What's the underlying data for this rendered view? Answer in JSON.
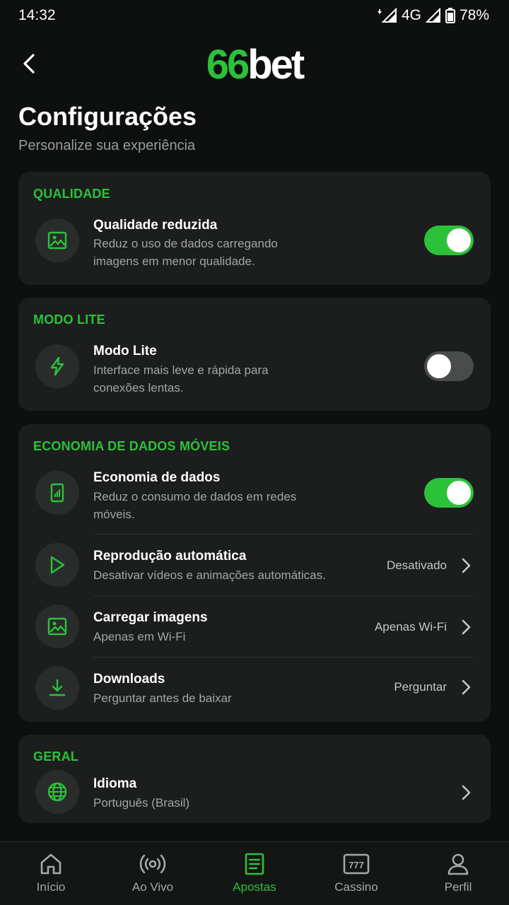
{
  "status_bar": {
    "time": "14:32",
    "network": "4G",
    "battery": "78%"
  },
  "header": {
    "logo_number": "66",
    "logo_word": "bet"
  },
  "page": {
    "title": "Configurações",
    "subtitle": "Personalize sua experiência"
  },
  "sections": {
    "quality": {
      "title": "QUALIDADE",
      "rows": [
        {
          "title": "Qualidade reduzida",
          "desc": "Reduz o uso de dados carregando imagens em menor qualidade.",
          "toggle": true,
          "icon": "image-icon"
        }
      ]
    },
    "lite": {
      "title": "MODO LITE",
      "rows": [
        {
          "title": "Modo Lite",
          "desc": "Interface mais leve e rápida para conexões lentas.",
          "toggle": false,
          "icon": "lightning-icon"
        }
      ]
    },
    "data": {
      "title": "ECONOMIA DE DADOS MÓVEIS",
      "rows": [
        {
          "title": "Economia de dados",
          "desc": "Reduz o consumo de dados em redes móveis.",
          "toggle": true,
          "icon": "mobile-data-icon"
        },
        {
          "title": "Reprodução automática",
          "desc": "Desativar vídeos e animações automáticas.",
          "value": "Desativado",
          "icon": "autoplay-icon"
        },
        {
          "title": "Carregar imagens",
          "desc": "Apenas em Wi-Fi",
          "value": "Apenas Wi-Fi",
          "icon": "image-icon"
        },
        {
          "title": "Downloads",
          "desc": "Perguntar antes de baixar",
          "value": "Perguntar",
          "icon": "download-icon"
        }
      ]
    },
    "general": {
      "title": "GERAL",
      "rows": [
        {
          "title": "Idioma",
          "desc": "Português (Brasil)",
          "icon": "globe-icon"
        }
      ]
    }
  },
  "bottom_nav": {
    "items": [
      {
        "label": "Início",
        "icon": "home-icon"
      },
      {
        "label": "Ao Vivo",
        "icon": "live-icon"
      },
      {
        "label": "Apostas",
        "icon": "bets-icon",
        "active": true
      },
      {
        "label": "Cassino",
        "icon": "slot-machine-icon"
      },
      {
        "label": "Perfil",
        "icon": "profile-icon"
      }
    ]
  },
  "colors": {
    "accent": "#2bc23a",
    "background": "#0e0f0f",
    "card": "#1c1d1d"
  }
}
